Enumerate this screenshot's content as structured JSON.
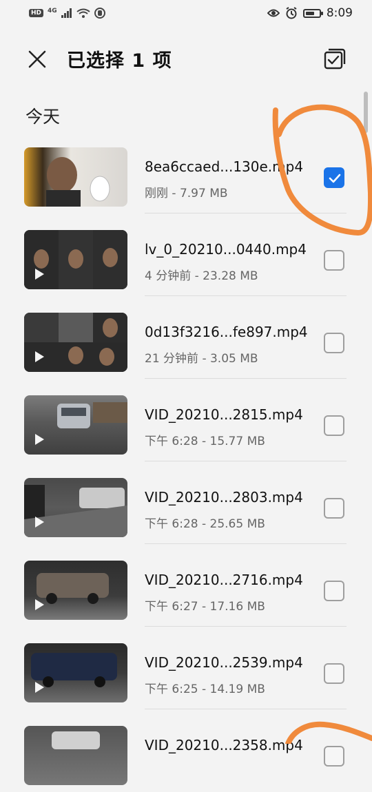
{
  "status_bar": {
    "time": "8:09",
    "hd": "HD",
    "network": "4G"
  },
  "header": {
    "title": "已选择 1 项"
  },
  "section": {
    "title": "今天"
  },
  "files": [
    {
      "name": "8ea6ccaed...130e.mp4",
      "meta": "刚刚 - 7.97 MB",
      "checked": true
    },
    {
      "name": "lv_0_20210...0440.mp4",
      "meta": "4 分钟前 - 23.28 MB",
      "checked": false
    },
    {
      "name": "0d13f3216...fe897.mp4",
      "meta": "21 分钟前 - 3.05 MB",
      "checked": false
    },
    {
      "name": "VID_20210...2815.mp4",
      "meta": "下午 6:28 - 15.77 MB",
      "checked": false
    },
    {
      "name": "VID_20210...2803.mp4",
      "meta": "下午 6:28 - 25.65 MB",
      "checked": false
    },
    {
      "name": "VID_20210...2716.mp4",
      "meta": "下午 6:27 - 17.16 MB",
      "checked": false
    },
    {
      "name": "VID_20210...2539.mp4",
      "meta": "下午 6:25 - 14.19 MB",
      "checked": false
    },
    {
      "name": "VID_20210...2358.mp4",
      "meta": "",
      "checked": false
    }
  ],
  "colors": {
    "accent": "#1a73e8",
    "annotation": "#f08a3c"
  }
}
